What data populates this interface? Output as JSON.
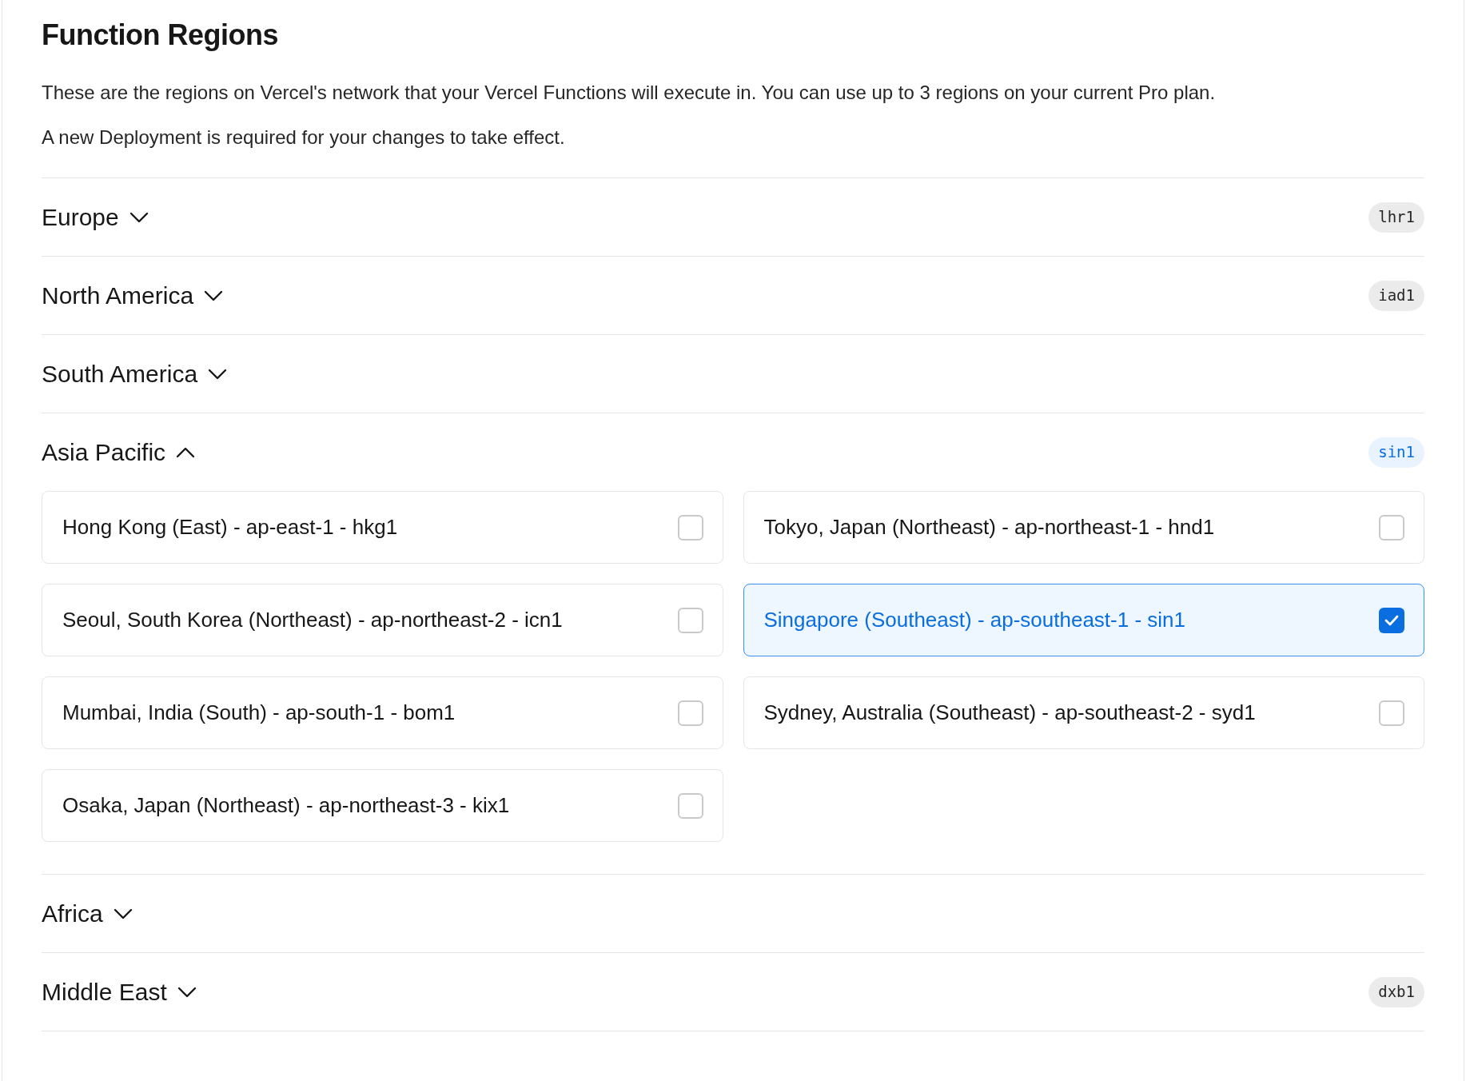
{
  "title": "Function Regions",
  "paragraphs": [
    "These are the regions on Vercel's network that your Vercel Functions will execute in. You can use up to 3 regions on your current Pro plan.",
    "A new Deployment is required for your changes to take effect."
  ],
  "sections": [
    {
      "name": "Europe",
      "expanded": false,
      "badge": {
        "text": "lhr1",
        "active": false
      }
    },
    {
      "name": "North America",
      "expanded": false,
      "badge": {
        "text": "iad1",
        "active": false
      }
    },
    {
      "name": "South America",
      "expanded": false
    },
    {
      "name": "Asia Pacific",
      "expanded": true,
      "badge": {
        "text": "sin1",
        "active": true
      },
      "regions": [
        {
          "label": "Hong Kong (East) - ap-east-1 - hkg1",
          "checked": false
        },
        {
          "label": "Tokyo, Japan (Northeast) - ap-northeast-1 - hnd1",
          "checked": false
        },
        {
          "label": "Seoul, South Korea (Northeast) - ap-northeast-2 - icn1",
          "checked": false
        },
        {
          "label": "Singapore (Southeast) - ap-southeast-1 - sin1",
          "checked": true
        },
        {
          "label": "Mumbai, India (South) - ap-south-1 - bom1",
          "checked": false
        },
        {
          "label": "Sydney, Australia (Southeast) - ap-southeast-2 - syd1",
          "checked": false
        },
        {
          "label": "Osaka, Japan (Northeast) - ap-northeast-3 - kix1",
          "checked": false
        }
      ]
    },
    {
      "name": "Africa",
      "expanded": false
    },
    {
      "name": "Middle East",
      "expanded": false,
      "badge": {
        "text": "dxb1",
        "active": false
      }
    }
  ]
}
